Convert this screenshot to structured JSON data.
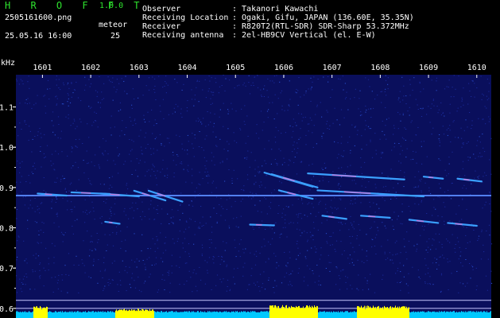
{
  "header": {
    "app_name": "H R O F F T",
    "version": "1.0.0",
    "filename": "2505161600.png",
    "datetime": "25.05.16 16:00",
    "meteor_label": "meteor",
    "meteor_count": "25",
    "info_labels": [
      "Observer",
      "Receiving Location",
      "Receiver",
      "Receiving antenna"
    ],
    "info_values": [
      ": Takanori Kawachi",
      ": Ogaki, Gifu, JAPAN (136.60E, 35.35N)",
      ": R820T2(RTL-SDR) SDR-Sharp 53.372MHz",
      ": 2el-HB9CV Vertical (el. E-W)"
    ]
  },
  "colors": {
    "background": "#000000",
    "plot_bg": "#0a0f5c",
    "axis_text": "#2ee32e",
    "label_text": "#ffffff",
    "power_bar_yellow": "#ffff00",
    "power_bar_cyan": "#00c8ff"
  },
  "chart_data": {
    "type": "heatmap",
    "ylabel": "kHz",
    "x_ticks": [
      "1601",
      "1602",
      "1603",
      "1604",
      "1605",
      "1606",
      "1607",
      "1608",
      "1609",
      "1610"
    ],
    "y_ticks": [
      "1.1",
      "1.0",
      "0.9",
      "0.8",
      "0.7",
      "0.6"
    ],
    "y_tick_values": [
      1.1,
      1.0,
      0.9,
      0.8,
      0.7,
      0.6
    ],
    "ylim": [
      0.58,
      1.18
    ],
    "xlim": [
      1600.45,
      1610.3
    ],
    "carrier_khz": 0.88,
    "meteor_traces": [
      {
        "x0": 1600.9,
        "y0": 0.885,
        "x1": 1601.5,
        "y1": 0.88
      },
      {
        "x0": 1601.6,
        "y0": 0.888,
        "x1": 1602.4,
        "y1": 0.884
      },
      {
        "x0": 1602.2,
        "y0": 0.885,
        "x1": 1603.0,
        "y1": 0.878
      },
      {
        "x0": 1602.9,
        "y0": 0.892,
        "x1": 1603.55,
        "y1": 0.868
      },
      {
        "x0": 1603.2,
        "y0": 0.892,
        "x1": 1603.9,
        "y1": 0.865
      },
      {
        "x0": 1602.3,
        "y0": 0.815,
        "x1": 1602.6,
        "y1": 0.81
      },
      {
        "x0": 1605.6,
        "y0": 0.937,
        "x1": 1606.6,
        "y1": 0.902
      },
      {
        "x0": 1605.75,
        "y0": 0.933,
        "x1": 1606.7,
        "y1": 0.9
      },
      {
        "x0": 1606.5,
        "y0": 0.935,
        "x1": 1608.5,
        "y1": 0.92
      },
      {
        "x0": 1605.9,
        "y0": 0.893,
        "x1": 1606.6,
        "y1": 0.872
      },
      {
        "x0": 1606.7,
        "y0": 0.893,
        "x1": 1608.9,
        "y1": 0.878
      },
      {
        "x0": 1608.9,
        "y0": 0.927,
        "x1": 1609.3,
        "y1": 0.922
      },
      {
        "x0": 1609.6,
        "y0": 0.922,
        "x1": 1610.1,
        "y1": 0.915
      },
      {
        "x0": 1605.3,
        "y0": 0.808,
        "x1": 1605.8,
        "y1": 0.806
      },
      {
        "x0": 1606.8,
        "y0": 0.83,
        "x1": 1607.3,
        "y1": 0.822
      },
      {
        "x0": 1607.6,
        "y0": 0.83,
        "x1": 1608.2,
        "y1": 0.825
      },
      {
        "x0": 1608.6,
        "y0": 0.82,
        "x1": 1609.2,
        "y1": 0.812
      },
      {
        "x0": 1609.4,
        "y0": 0.812,
        "x1": 1610.0,
        "y1": 0.805
      }
    ],
    "power_bursts": [
      {
        "x0": 1600.45,
        "x1": 1610.3,
        "level": 0.35
      },
      {
        "x0": 1600.8,
        "x1": 1601.1,
        "level": 0.8
      },
      {
        "x0": 1602.5,
        "x1": 1603.3,
        "level": 0.55
      },
      {
        "x0": 1605.7,
        "x1": 1606.7,
        "level": 0.9
      },
      {
        "x0": 1607.5,
        "x1": 1608.6,
        "level": 0.85
      }
    ]
  }
}
